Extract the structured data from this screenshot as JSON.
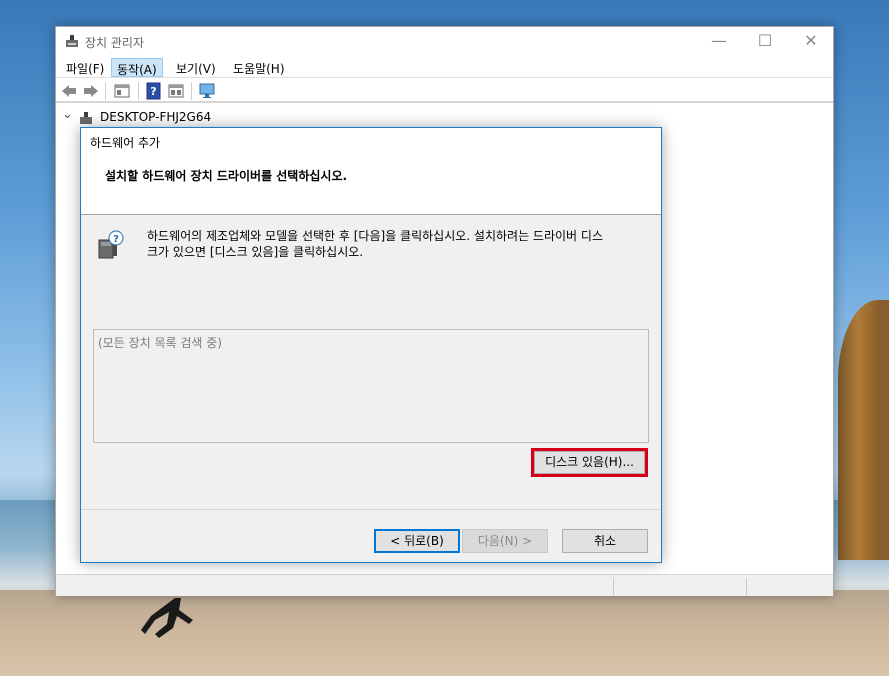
{
  "window": {
    "title": "장치 관리자",
    "controls": {
      "minimize": "—",
      "maximize": "☐",
      "close": "✕"
    }
  },
  "menu": {
    "items": [
      "파일(F)",
      "동작(A)",
      "보기(V)",
      "도움말(H)"
    ],
    "active_index": 1
  },
  "toolbar": {
    "icons": [
      "back-icon",
      "forward-icon",
      "properties-icon",
      "help-icon",
      "panel-icon",
      "monitor-icon"
    ]
  },
  "tree": {
    "root_label": "DESKTOP-FHJ2G64",
    "expand_glyph": "⌄"
  },
  "dialog": {
    "title": "하드웨어 추가",
    "heading": "설치할 하드웨어 장치 드라이버를 선택하십시오.",
    "instruction_line1": "하드웨어의 제조업체와 모델을 선택한 후 [다음]을 클릭하십시오. 설치하려는 드라이버 디스",
    "instruction_line2": "크가 있으면 [디스크 있음]을 클릭하십시오.",
    "list_status": "(모든 장치 목록 검색 중)",
    "buttons": {
      "have_disk": "디스크 있음(H)...",
      "back": "< 뒤로(B)",
      "next": "다음(N) >",
      "cancel": "취소"
    }
  },
  "colors": {
    "accent": "#0078d7",
    "highlight": "#d4001a",
    "menu_active": "#cce4f7"
  }
}
